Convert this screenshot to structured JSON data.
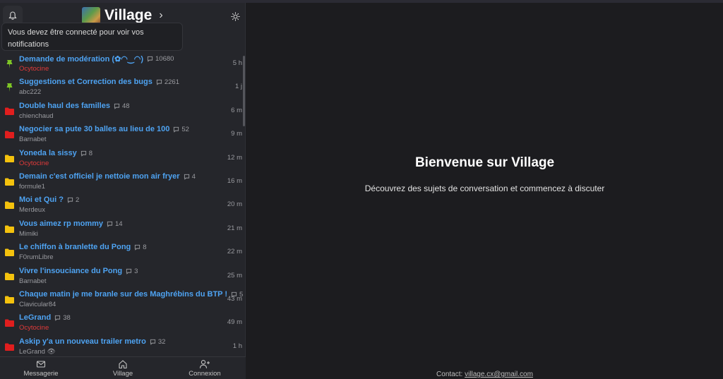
{
  "header": {
    "title": "Village",
    "chevron": "›",
    "notification_tooltip": "Vous devez être connecté pour voir vos notifications"
  },
  "topics": [
    {
      "title": "Demande de modération (✿◠‿◠)",
      "count": "10680",
      "author": "Ocytocine",
      "author_color": "red",
      "time": "5 h",
      "icon": "pin-icon"
    },
    {
      "title": "Suggestions et Correction des bugs",
      "count": "2261",
      "author": "abc222",
      "author_color": "gray",
      "time": "1 j",
      "icon": "pin-icon"
    },
    {
      "title": "Double haul des familles",
      "count": "48",
      "author": "chienchaud",
      "author_color": "gray",
      "time": "6 m",
      "icon": "folder-red-icon"
    },
    {
      "title": "Negocier sa pute 30 balles au lieu de 100",
      "count": "52",
      "author": "Barnabet",
      "author_color": "gray",
      "time": "9 m",
      "icon": "folder-red-icon"
    },
    {
      "title": "Yoneda la sissy",
      "count": "8",
      "author": "Ocytocine",
      "author_color": "red",
      "time": "12 m",
      "icon": "folder-yellow-icon"
    },
    {
      "title": "Demain c'est officiel je nettoie mon air fryer",
      "count": "4",
      "author": "formule1",
      "author_color": "gray",
      "time": "16 m",
      "icon": "folder-yellow-icon"
    },
    {
      "title": "Moi et Qui ?",
      "count": "2",
      "author": "Merdeux",
      "author_color": "gray",
      "time": "20 m",
      "icon": "folder-yellow-icon"
    },
    {
      "title": "Vous aimez rp mommy",
      "count": "14",
      "author": "Mimiki",
      "author_color": "gray",
      "time": "21 m",
      "icon": "folder-yellow-icon"
    },
    {
      "title": "Le chiffon à branlette du Pong",
      "count": "8",
      "author": "F0rumLibre",
      "author_color": "gray",
      "time": "22 m",
      "icon": "folder-yellow-icon"
    },
    {
      "title": "Vivre l'insouciance du Pong",
      "count": "3",
      "author": "Barnabet",
      "author_color": "gray",
      "time": "25 m",
      "icon": "folder-yellow-icon"
    },
    {
      "title": "Chaque matin je me branle sur des Maghrébins du BTP !",
      "count": "5",
      "author": "Clavicular84",
      "author_color": "gray",
      "time": "43 m",
      "icon": "folder-yellow-icon"
    },
    {
      "title": "LeGrand",
      "count": "38",
      "author": "Ocytocine",
      "author_color": "red",
      "time": "49 m",
      "icon": "folder-red-icon"
    },
    {
      "title": "Askip y'a un nouveau trailer metro",
      "count": "32",
      "author": "LeGrand 👁",
      "author_color": "gray",
      "time": "1 h",
      "icon": "folder-red-icon"
    }
  ],
  "bottom_nav": {
    "messages": "Messagerie",
    "village": "Village",
    "login": "Connexion"
  },
  "main": {
    "welcome": "Bienvenue sur Village",
    "subtitle": "Découvrez des sujets de conversation et commencez à discuter",
    "contact_label": "Contact:",
    "contact_email": "village.cx@gmail.com"
  },
  "colors": {
    "link_blue": "#4ea3f2",
    "author_red": "#e03a3a",
    "pin_green": "#7ec626",
    "folder_red": "#e11e1e",
    "folder_yellow": "#f4c20d"
  }
}
